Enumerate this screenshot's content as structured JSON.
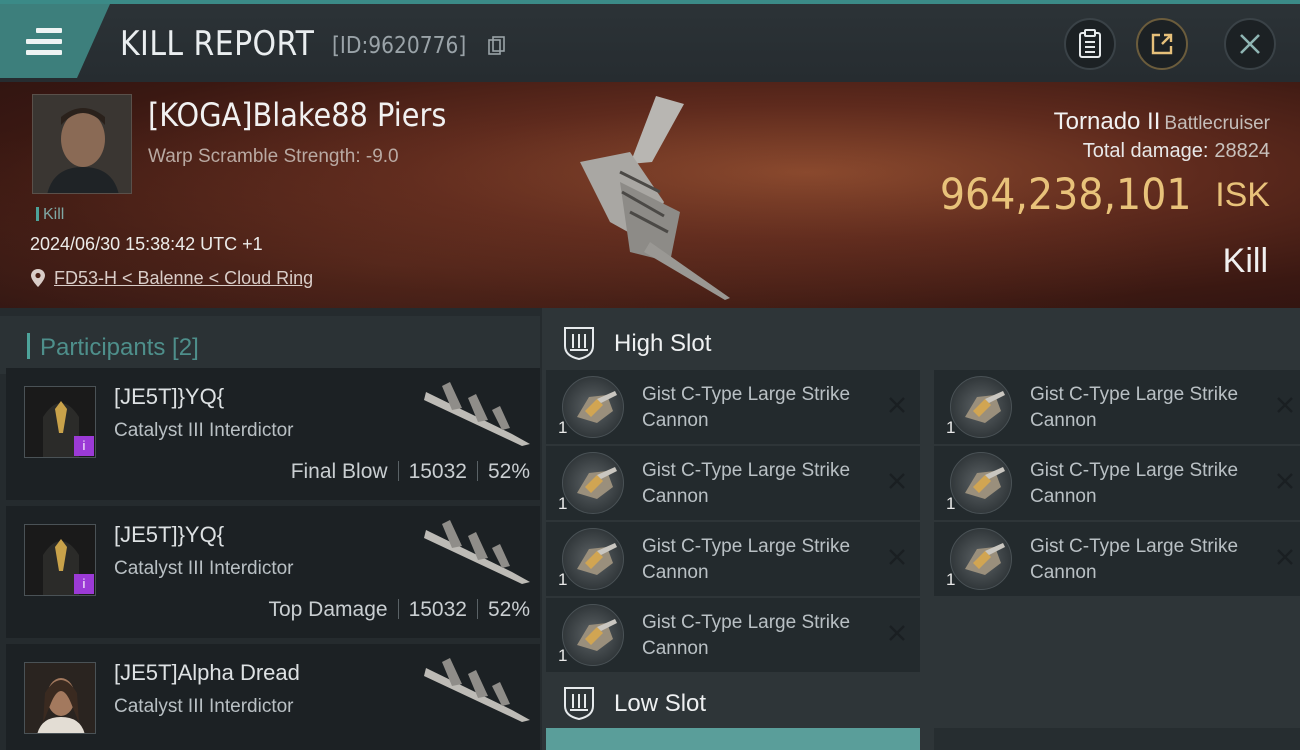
{
  "header": {
    "title": "KILL REPORT",
    "report_id": "[ID:9620776]"
  },
  "victim": {
    "name": "[KOGA]Blake88 Piers",
    "scramble": "Warp Scramble Strength: -9.0",
    "tag": "Kill",
    "timestamp": "2024/06/30 15:38:42 UTC +1",
    "location": "FD53-H < Balenne < Cloud Ring",
    "ship_name": "Tornado II",
    "ship_class": "Battlecruiser",
    "total_damage_label": "Total damage:",
    "total_damage": "28824",
    "isk_value": "964,238,101",
    "isk_unit": "ISK",
    "result": "Kill"
  },
  "participants": {
    "title": "Participants [2]",
    "items": [
      {
        "name": "[JE5T]}YQ{",
        "ship": "Catalyst III Interdictor",
        "label": "Final Blow",
        "damage": "15032",
        "percent": "52%",
        "badge": "i"
      },
      {
        "name": "[JE5T]}YQ{",
        "ship": "Catalyst III Interdictor",
        "label": "Top Damage",
        "damage": "15032",
        "percent": "52%",
        "badge": "i"
      },
      {
        "name": "[JE5T]Alpha Dread",
        "ship": "Catalyst III Interdictor"
      }
    ]
  },
  "high_slot": {
    "title": "High Slot",
    "modules": [
      {
        "name": "Gist C-Type Large Strike Cannon",
        "qty": "1"
      },
      {
        "name": "Gist C-Type Large Strike Cannon",
        "qty": "1"
      },
      {
        "name": "Gist C-Type Large Strike Cannon",
        "qty": "1"
      },
      {
        "name": "Gist C-Type Large Strike Cannon",
        "qty": "1"
      },
      {
        "name": "Gist C-Type Large Strike Cannon",
        "qty": "1"
      },
      {
        "name": "Gist C-Type Large Strike Cannon",
        "qty": "1"
      },
      {
        "name": "Gist C-Type Large Strike Cannon",
        "qty": "1"
      }
    ]
  },
  "low_slot": {
    "title": "Low Slot"
  },
  "colors": {
    "accent": "#3d7f7c",
    "isk": "#e8c27a",
    "badge": "#9b3ad6"
  }
}
